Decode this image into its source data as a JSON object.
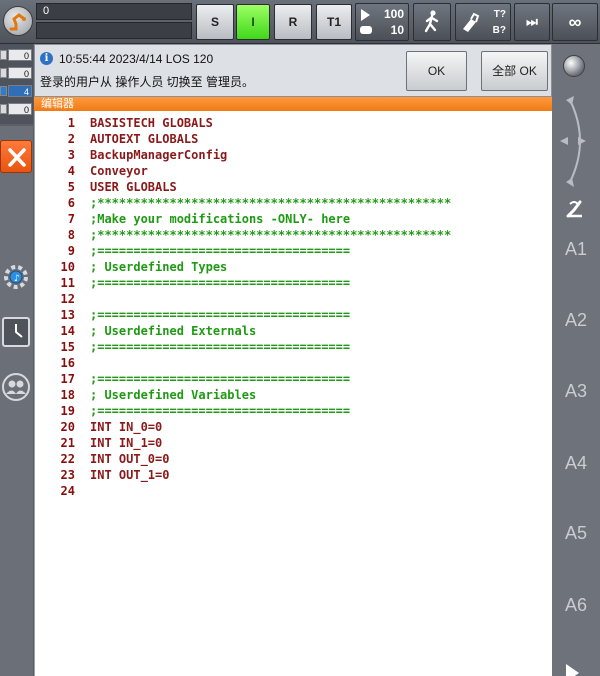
{
  "toolbar": {
    "progress_value": "0",
    "mode_s": "S",
    "mode_i": "I",
    "mode_r": "R",
    "mode_t1": "T1",
    "override_top": "100",
    "override_bottom": "10",
    "tool_t": "T?",
    "tool_b": "B?",
    "skip": "⏭",
    "infinity": "∞"
  },
  "status": {
    "values": [
      "0",
      "0",
      "4",
      "0"
    ]
  },
  "message": {
    "time": "10:55:44 2023/4/14 LOS 120",
    "text": "登录的用户从 操作人员 切换至 管理员。",
    "ok": "OK",
    "ok_all": "全部 OK"
  },
  "editor": {
    "tab": "编辑器",
    "lines": [
      {
        "n": "1",
        "code": "BASISTECH GLOBALS",
        "style": "dark"
      },
      {
        "n": "2",
        "code": "AUTOEXT GLOBALS",
        "style": "dark"
      },
      {
        "n": "3",
        "code": "BackupManagerConfig",
        "style": "dark"
      },
      {
        "n": "4",
        "code": "Conveyor",
        "style": "dark"
      },
      {
        "n": "5",
        "code": "USER GLOBALS",
        "style": "dark"
      },
      {
        "n": "6",
        "code": ";*************************************************",
        "style": "green"
      },
      {
        "n": "7",
        "code": ";Make your modifications -ONLY- here",
        "style": "green"
      },
      {
        "n": "8",
        "code": ";*************************************************",
        "style": "green"
      },
      {
        "n": "9",
        "code": ";===================================",
        "style": "green"
      },
      {
        "n": "10",
        "code": "; Userdefined Types",
        "style": "green"
      },
      {
        "n": "11",
        "code": ";===================================",
        "style": "green"
      },
      {
        "n": "12",
        "code": "",
        "style": "green"
      },
      {
        "n": "13",
        "code": ";===================================",
        "style": "green"
      },
      {
        "n": "14",
        "code": "; Userdefined Externals",
        "style": "green"
      },
      {
        "n": "15",
        "code": ";===================================",
        "style": "green"
      },
      {
        "n": "16",
        "code": "",
        "style": "green"
      },
      {
        "n": "17",
        "code": ";===================================",
        "style": "green"
      },
      {
        "n": "18",
        "code": "; Userdefined Variables",
        "style": "green"
      },
      {
        "n": "19",
        "code": ";===================================",
        "style": "green"
      },
      {
        "n": "20",
        "code": "INT IN_0=0",
        "style": "dark"
      },
      {
        "n": "21",
        "code": "INT IN_1=0",
        "style": "dark"
      },
      {
        "n": "22",
        "code": "INT OUT_0=0",
        "style": "dark"
      },
      {
        "n": "23",
        "code": "INT OUT_1=0",
        "style": "dark"
      },
      {
        "n": "24",
        "code": "",
        "style": "dark"
      }
    ]
  },
  "right": {
    "axes": [
      "A1",
      "A2",
      "A3",
      "A4",
      "A5",
      "A6"
    ]
  }
}
